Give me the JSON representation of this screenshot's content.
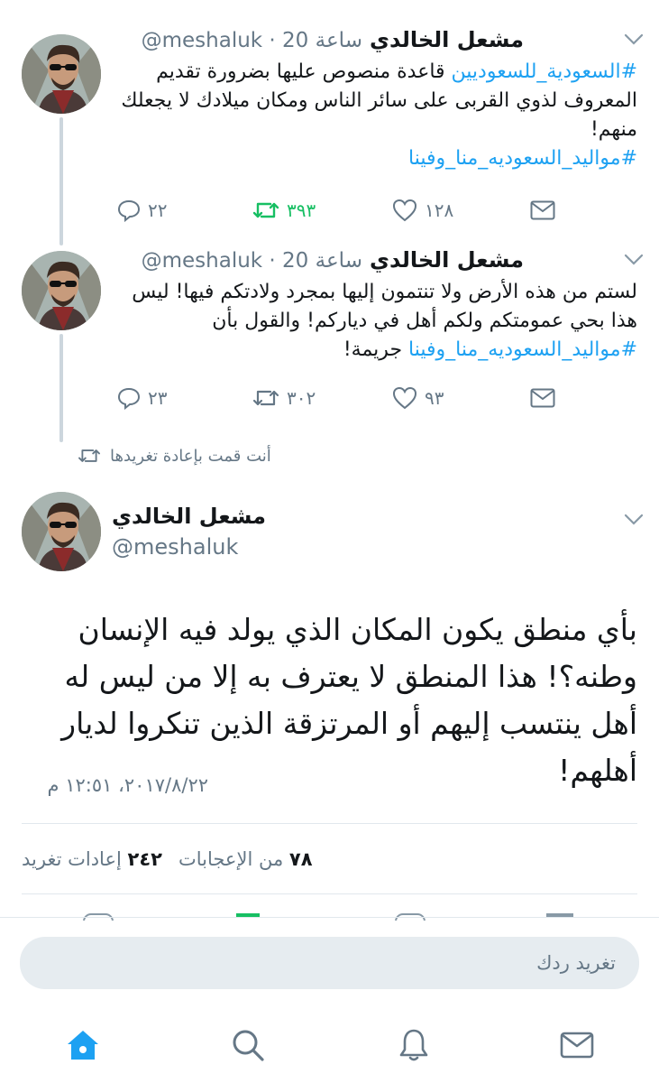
{
  "tweets": [
    {
      "name": "مشعل الخالدي",
      "handle": "@meshaluk",
      "time": "20 ساعة",
      "text_parts": [
        {
          "t": "#السعودية_للسعوديين",
          "tag": true
        },
        {
          "t": " قاعدة منصوص عليها بضرورة تقديم المعروف لذوي القربى على سائر الناس ومكان ميلادك لا يجعلك منهم!",
          "tag": false
        },
        {
          "t": "#مواليد_السعوديه_منا_وفينا",
          "tag": true,
          "newline": true
        }
      ],
      "replies": "٢٢",
      "retweets": "٣٩٣",
      "likes": "١٢٨",
      "retweeted": true
    },
    {
      "name": "مشعل الخالدي",
      "handle": "@meshaluk",
      "time": "20 ساعة",
      "text_parts": [
        {
          "t": "لستم من هذه الأرض ولا تنتمون إليها بمجرد ولادتكم فيها! ليس هذا بحي عمومتكم ولكم أهل في دياركم! والقول بأن ",
          "tag": false
        },
        {
          "t": "#مواليد_السعوديه_منا_وفينا",
          "tag": true
        },
        {
          "t": " جريمة!",
          "tag": false
        }
      ],
      "replies": "٢٣",
      "retweets": "٣٠٢",
      "likes": "٩٣",
      "retweeted": false
    }
  ],
  "retweet_context": "أنت قمت بإعادة تغريدها",
  "main_tweet": {
    "name": "مشعل الخالدي",
    "handle": "@meshaluk",
    "text": "بأي منطق يكون المكان الذي يولد فيه الإنسان وطنه؟! هذا المنطق لا يعترف به إلا من ليس له أهل ينتسب إليهم أو المرتزقة الذين تنكروا لديار أهلهم!",
    "datetime": "٢٠١٧/٨/٢٢، ١٢:٥١ م",
    "retweets_count": "٢٤٢",
    "retweets_label": "إعادات تغريد",
    "likes_count": "٧٨",
    "likes_label": "من الإعجابات"
  },
  "reply_box": {
    "placeholder": "تغريد ردك"
  },
  "nav": [
    "home-icon",
    "search-icon",
    "notifications-icon",
    "messages-icon"
  ],
  "colors": {
    "accent": "#1da1f2",
    "retweet_active": "#17bf63",
    "muted": "#657786"
  }
}
